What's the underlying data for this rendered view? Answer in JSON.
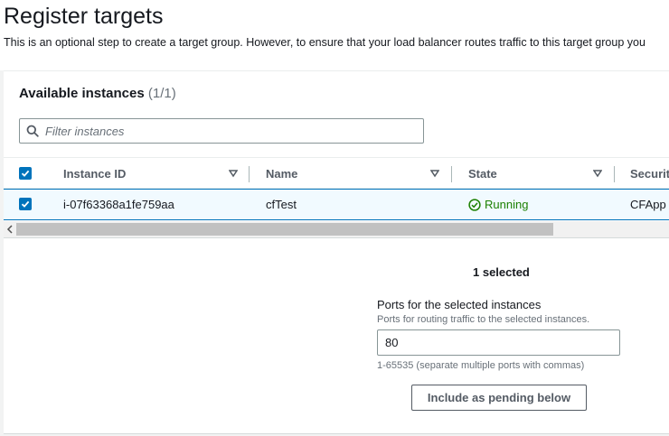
{
  "header": {
    "title": "Register targets",
    "description": "This is an optional step to create a target group. However, to ensure that your load balancer routes traffic to this target group you"
  },
  "instances": {
    "title": "Available instances",
    "count": "(1/1)",
    "filter_placeholder": "Filter instances",
    "columns": [
      "Instance ID",
      "Name",
      "State",
      "Security"
    ],
    "rows": [
      {
        "instance_id": "i-07f63368a1fe759aa",
        "name": "cfTest",
        "state": "Running",
        "security": "CFApp",
        "selected": true
      }
    ]
  },
  "selection": {
    "selected_text": "1 selected",
    "ports_label": "Ports for the selected instances",
    "ports_description": "Ports for routing traffic to the selected instances.",
    "ports_value": "80",
    "ports_constraint": "1-65535 (separate multiple ports with commas)",
    "include_button": "Include as pending below"
  },
  "colors": {
    "accent": "#0073bb",
    "running": "#1d8102",
    "selected_row_bg": "#f1faff"
  },
  "icons": [
    "search-icon",
    "checkmark-icon",
    "sort-down-icon",
    "status-running-icon",
    "scroll-left-icon"
  ]
}
